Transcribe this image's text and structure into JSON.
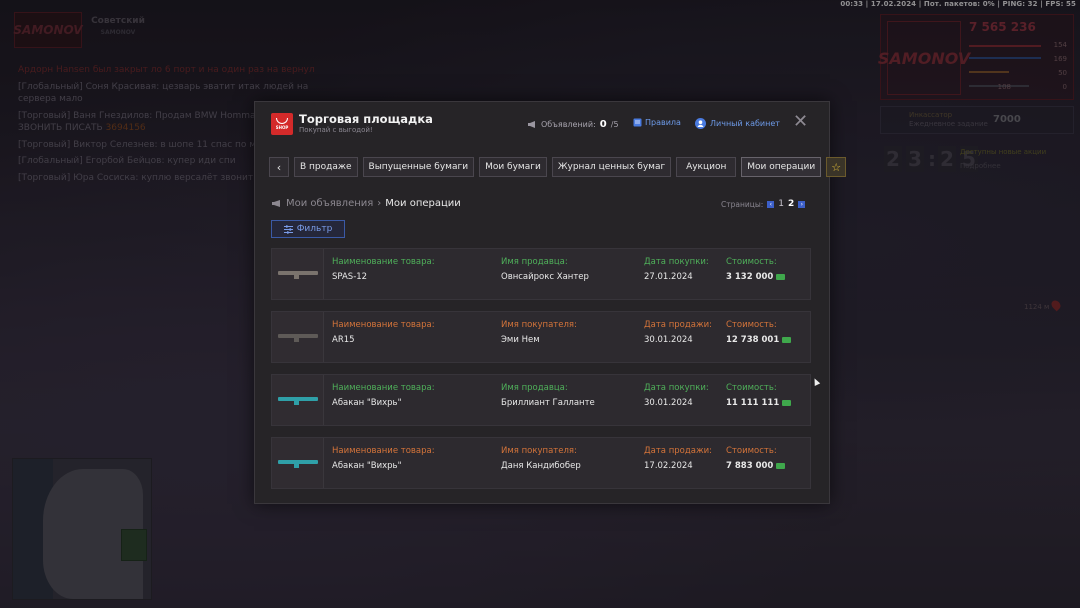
{
  "status_bar": "00:33 | 17.02.2024 | Пот. пакетов: 0% | PING: 32 | FPS: 55",
  "family": {
    "logo": "SAMONOV",
    "name": "Советский",
    "sub": "SAMONOV"
  },
  "chat": [
    {
      "text": "Ардорн Hansen был закрыт ло 6 порт и на один раз на вернул",
      "color": "red"
    },
    {
      "text": "[Глобальный] Соня Красивая: цезварь эватит итак людей на сервера мало",
      "color": "gray"
    },
    {
      "text": "[Торговый] Ваня Гнездилов: Продам BMW Hommage едет 367 ЗВОНИТЬ ПИСАТЬ",
      "suffix": "3694156",
      "color": "gray"
    },
    {
      "text": "[Торговый] Виктор Селезнев: в шопе 11 спас по мин",
      "color": "gray"
    },
    {
      "text": "[Глобальный] Егорбой Бейцов: купер иди спи",
      "color": "gray"
    },
    {
      "text": "[Торговый] Юра Сосиска: куплю версалёт звонить",
      "color": "gray"
    }
  ],
  "hud": {
    "logo": "SAMONOV",
    "money": "7 565 236",
    "stats": [
      "154",
      "169",
      "50",
      "0"
    ],
    "level": "108",
    "quest_title": "Инкассатор",
    "quest_sub": "Ежедневное задание",
    "quest_value": "7000",
    "clock_h": [
      "2",
      "3"
    ],
    "clock_m": [
      "2",
      "5"
    ],
    "actions_title": "Доступны новые акции",
    "actions_sub": "Подробнее",
    "distance": "1124 м"
  },
  "modal": {
    "shop_badge": "SHOP",
    "title": "Торговая площадка",
    "subtitle": "Покупай с выгодой!",
    "ads_label": "Объявлений:",
    "ads_count": "0",
    "ads_max": "/5",
    "rules_label": "Правила",
    "cabinet_label": "Личный кабинет",
    "tabs": [
      {
        "label": "В продаже"
      },
      {
        "label": "Выпущенные бумаги"
      },
      {
        "label": "Мои бумаги"
      },
      {
        "label": "Журнал ценных бумаг"
      },
      {
        "label": "Аукцион"
      },
      {
        "label": "Мои операции"
      }
    ],
    "breadcrumb_parent": "Мои объявления",
    "breadcrumb_current": "Мои операции",
    "pages_label": "Страницы:",
    "pages": [
      "1",
      "2"
    ],
    "current_page": "2",
    "filter_label": "Фильтр",
    "orders": [
      {
        "item_label": "Наименование товара:",
        "item": "SPAS-12",
        "party_label": "Имя продавца:",
        "party": "Овнсайрокс Хантер",
        "date_label": "Дата покупки:",
        "date": "27.01.2024",
        "price_label": "Стоимость:",
        "price": "3 132 000",
        "type": "purchase",
        "gun_color": "#7a736d"
      },
      {
        "item_label": "Наименование товара:",
        "item": "AR15",
        "party_label": "Имя покупателя:",
        "party": "Эми Нем",
        "date_label": "Дата продажи:",
        "date": "30.01.2024",
        "price_label": "Стоимость:",
        "price": "12 738 001",
        "type": "sale",
        "gun_color": "#5e5a57"
      },
      {
        "item_label": "Наименование товара:",
        "item": "Абакан \"Вихрь\"",
        "party_label": "Имя продавца:",
        "party": "Бриллиант Галланте",
        "date_label": "Дата покупки:",
        "date": "30.01.2024",
        "price_label": "Стоимость:",
        "price": "11 111 111",
        "type": "purchase",
        "gun_color": "#2fa0a8"
      },
      {
        "item_label": "Наименование товара:",
        "item": "Абакан \"Вихрь\"",
        "party_label": "Имя покупателя:",
        "party": "Даня Кандибобер",
        "date_label": "Дата продажи:",
        "date": "17.02.2024",
        "price_label": "Стоимость:",
        "price": "7 883 000",
        "type": "sale",
        "gun_color": "#2fa0a8"
      }
    ]
  }
}
